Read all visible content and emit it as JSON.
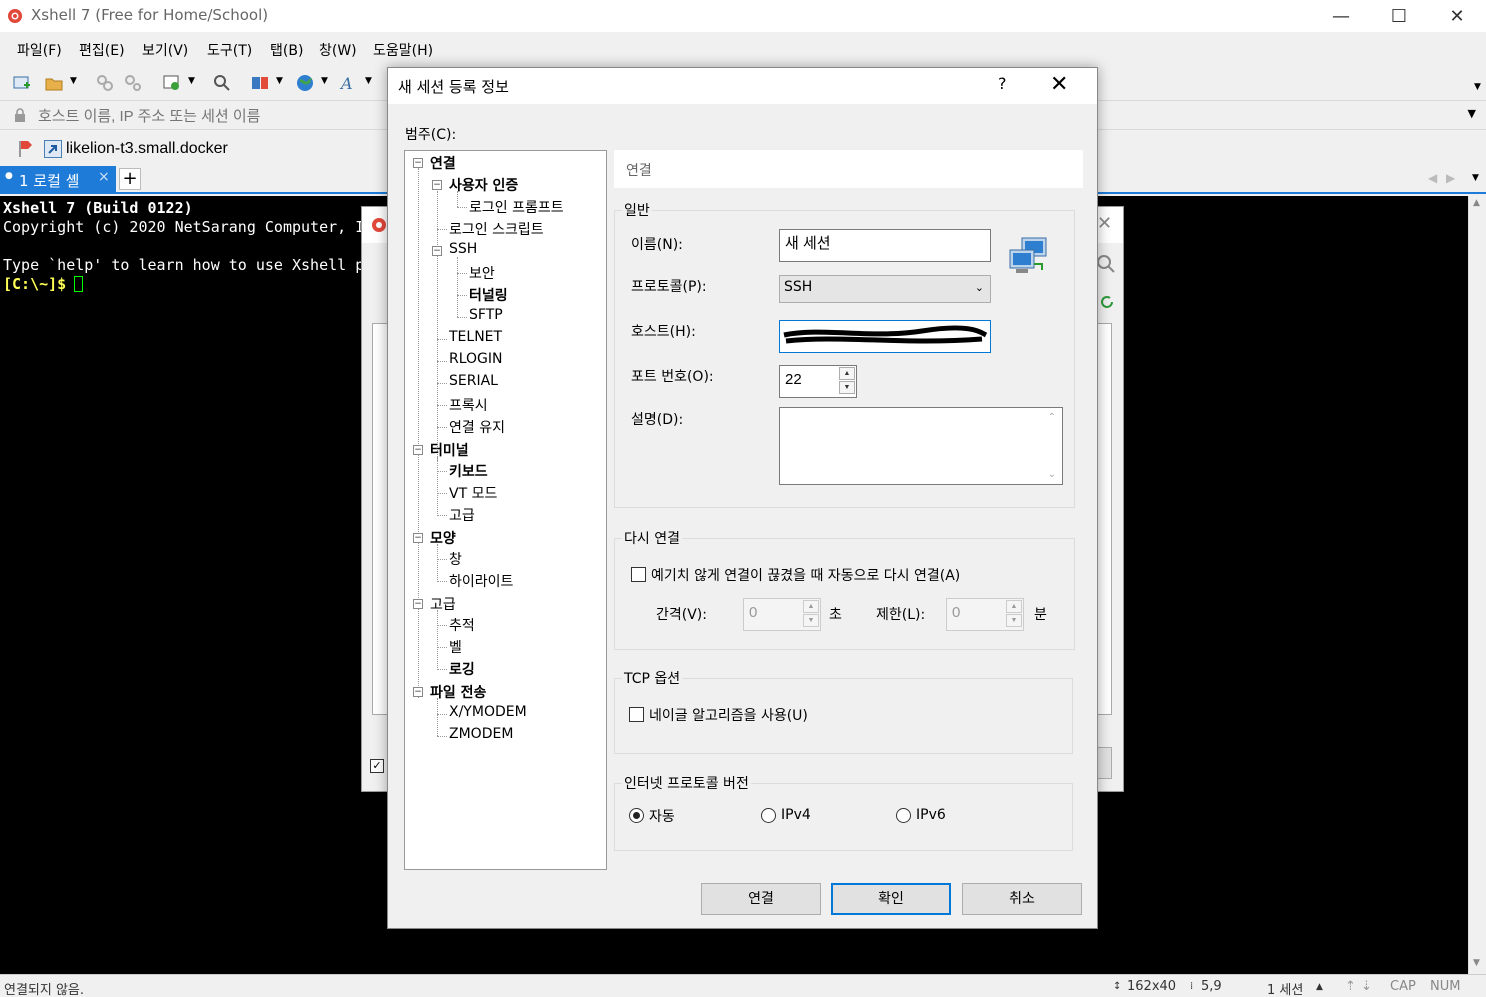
{
  "app": {
    "title": "Xshell 7 (Free for Home/School)",
    "win_min": "—",
    "win_max": "☐",
    "win_close": "✕"
  },
  "menu": [
    "파일(F)",
    "편집(E)",
    "보기(V)",
    "도구(T)",
    "탭(B)",
    "창(W)",
    "도움말(H)"
  ],
  "address": {
    "placeholder": "호스트 이름, IP 주소 또는 세션 이름"
  },
  "links": {
    "session_link": "likelion-t3.small.docker"
  },
  "tabs": {
    "local_shell": "1 로컬 셸",
    "close": "×",
    "add": "+"
  },
  "terminal": {
    "line1": "Xshell 7 (Build 0122)",
    "line2": "Copyright (c) 2020 NetSarang Computer, I",
    "line3": "Type `help' to learn how to use Xshell p",
    "prompt": "[C:\\~]$ "
  },
  "status": {
    "left": "연결되지 않음.",
    "size": "162x40",
    "cursor": "5,9",
    "sessions": "1 세션",
    "cap": "CAP",
    "num": "NUM"
  },
  "dialog": {
    "title": "새 세션 등록 정보",
    "help": "?",
    "close": "✕",
    "category_label": "범주(C):",
    "tree": {
      "connection": "연결",
      "user_auth": "사용자 인증",
      "login_prompt": "로그인 프롬프트",
      "login_script": "로그인 스크립트",
      "ssh": "SSH",
      "security": "보안",
      "tunneling": "터널링",
      "sftp": "SFTP",
      "telnet": "TELNET",
      "rlogin": "RLOGIN",
      "serial": "SERIAL",
      "proxy": "프록시",
      "keepalive": "연결 유지",
      "terminal": "터미널",
      "keyboard": "키보드",
      "vt_mode": "VT 모드",
      "advanced": "고급",
      "appearance": "모양",
      "window": "창",
      "highlight": "하이라이트",
      "advanced2": "고급",
      "trace": "추적",
      "bell": "벨",
      "logging": "로깅",
      "file_transfer": "파일 전송",
      "xymodem": "X/YMODEM",
      "zmodem": "ZMODEM"
    },
    "panel_header": "연결",
    "general": {
      "title": "일반",
      "name_label": "이름(N):",
      "name_value": "새 세션",
      "protocol_label": "프로토콜(P):",
      "protocol_value": "SSH",
      "host_label": "호스트(H):",
      "port_label": "포트 번호(O):",
      "port_value": "22",
      "desc_label": "설명(D):"
    },
    "reconnect": {
      "title": "다시 연결",
      "auto_label": "예기치 않게 연결이 끊겼을 때 자동으로 다시 연결(A)",
      "interval_label": "간격(V):",
      "interval_value": "0",
      "interval_unit": "초",
      "limit_label": "제한(L):",
      "limit_value": "0",
      "limit_unit": "분"
    },
    "tcp": {
      "title": "TCP 옵션",
      "nagle_label": "네이글 알고리즘을 사용(U)"
    },
    "ip_version": {
      "title": "인터넷 프로토콜 버전",
      "auto": "자동",
      "ipv4": "IPv4",
      "ipv6": "IPv6"
    },
    "buttons": {
      "connect": "연결",
      "ok": "확인",
      "cancel": "취소"
    }
  },
  "colors": {
    "accent": "#1e7bd8",
    "terminal_bg": "#000000",
    "prompt": "#ffff55",
    "cursor": "#00ff00"
  }
}
